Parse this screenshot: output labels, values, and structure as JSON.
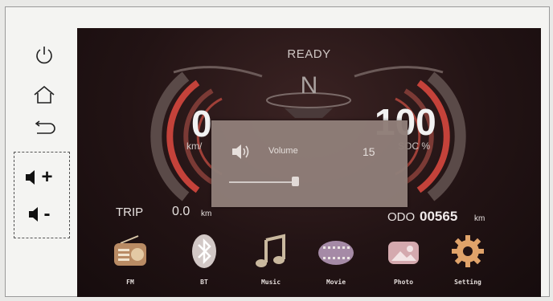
{
  "status": {
    "ready": "READY",
    "gear": "N"
  },
  "speed": {
    "value": "0",
    "unit": "km/"
  },
  "soc": {
    "value": "100",
    "unit": "SOC %"
  },
  "volume_popup": {
    "label": "Volume",
    "value": "15",
    "level_fraction": 0.38
  },
  "trip": {
    "label": "TRIP",
    "value": "0.0",
    "unit": "km"
  },
  "odo": {
    "label": "ODO",
    "value": "00565",
    "unit": "km"
  },
  "apps": [
    {
      "label": "FM",
      "icon": "radio-icon"
    },
    {
      "label": "BT",
      "icon": "bluetooth-icon"
    },
    {
      "label": "Music",
      "icon": "music-note-icon"
    },
    {
      "label": "Movie",
      "icon": "film-icon"
    },
    {
      "label": "Photo",
      "icon": "photo-icon"
    },
    {
      "label": "Setting",
      "icon": "gear-icon"
    }
  ],
  "side_buttons": [
    {
      "icon": "power-icon"
    },
    {
      "icon": "home-icon"
    },
    {
      "icon": "back-icon"
    },
    {
      "icon": "volume-up-icon",
      "symbol": "+"
    },
    {
      "icon": "volume-down-icon",
      "symbol": "-"
    }
  ],
  "colors": {
    "accent_red": "#c4423a",
    "screen_bg": "#221314",
    "overlay_bg": "#8f7e78"
  }
}
